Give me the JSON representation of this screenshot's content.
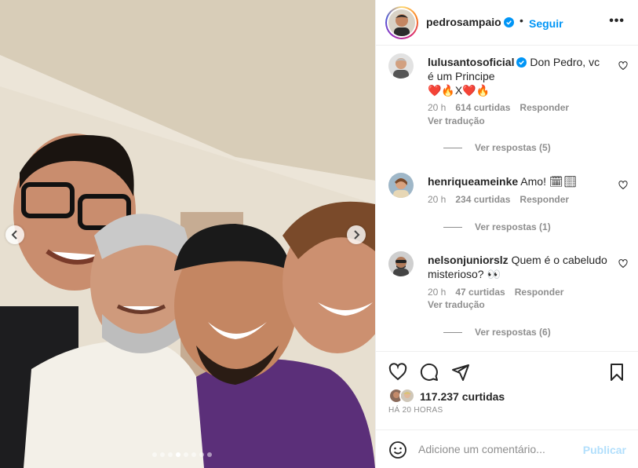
{
  "post": {
    "carousel_count": 8,
    "carousel_active": 3
  },
  "header": {
    "username": "pedrosampaio",
    "separator": "•",
    "follow_label": "Seguir",
    "more_label": "•••"
  },
  "comments": [
    {
      "username": "lulusantosoficial",
      "verified": true,
      "text_before_emoji": "Don Pedro, vc é um Principe",
      "emoji_line": "❤️🔥X❤️🔥",
      "time": "20 h",
      "likes": "614 curtidas",
      "reply_label": "Responder",
      "translate_label": "Ver tradução",
      "replies_label": "Ver respostas (5)"
    },
    {
      "username": "henriqueameinke",
      "verified": false,
      "text": "Amo! 🗓🏻",
      "time": "20 h",
      "likes": "234 curtidas",
      "reply_label": "Responder",
      "replies_label": "Ver respostas (1)"
    },
    {
      "username": "nelsonjuniorslz",
      "verified": false,
      "text": "Quem é o cabeludo misterioso? 👀",
      "time": "20 h",
      "likes": "47 curtidas",
      "reply_label": "Responder",
      "translate_label": "Ver tradução",
      "replies_label": "Ver respostas (6)"
    }
  ],
  "actions": {
    "likes_count": "117.237",
    "likes_word": "curtidas",
    "posted_ago": "HÁ 20 HORAS"
  },
  "add_comment": {
    "placeholder": "Adicione um comentário...",
    "publish_label": "Publicar"
  },
  "colors": {
    "accent": "#0095f6",
    "publish_disabled": "#b2dffc",
    "muted": "#8e8e8e",
    "text": "#262626"
  },
  "icons": [
    "chevron-left-icon",
    "chevron-right-icon",
    "verified-badge-icon",
    "more-icon",
    "heart-icon",
    "comment-icon",
    "share-icon",
    "bookmark-icon",
    "emoji-icon"
  ]
}
